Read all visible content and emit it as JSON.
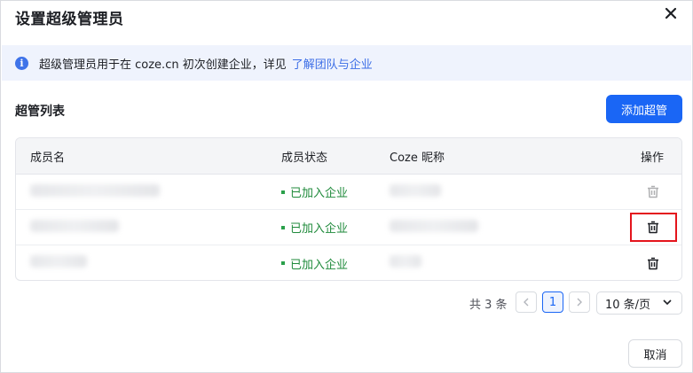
{
  "dialog": {
    "title": "设置超级管理员",
    "close_icon": "close-icon"
  },
  "notice": {
    "icon": "info-icon",
    "icon_glyph": "i",
    "text": "超级管理员用于在 coze.cn 初次创建企业，详见",
    "link": "了解团队与企业"
  },
  "section": {
    "title": "超管列表",
    "add_label": "添加超管"
  },
  "table": {
    "columns": [
      "成员名",
      "成员状态",
      "Coze 昵称",
      "操作"
    ],
    "rows": [
      {
        "status": "已加入企业",
        "delete_icon": "trash-icon",
        "delete_enabled": false
      },
      {
        "status": "已加入企业",
        "delete_icon": "trash-icon",
        "delete_enabled": true
      },
      {
        "status": "已加入企业",
        "delete_icon": "trash-icon",
        "delete_enabled": true
      }
    ]
  },
  "pagination": {
    "total_label": "共 3 条",
    "current_page": "1",
    "prev_icon": "chevron-left-icon",
    "next_icon": "chevron-right-icon",
    "page_size": "10 条/页",
    "page_size_icon": "chevron-down-icon"
  },
  "footer": {
    "cancel_label": "取消"
  },
  "colors": {
    "primary": "#1a66f5",
    "status_green": "#1f8a3b",
    "highlight_red": "#e4141c",
    "notice_bg": "#eff3fd"
  }
}
